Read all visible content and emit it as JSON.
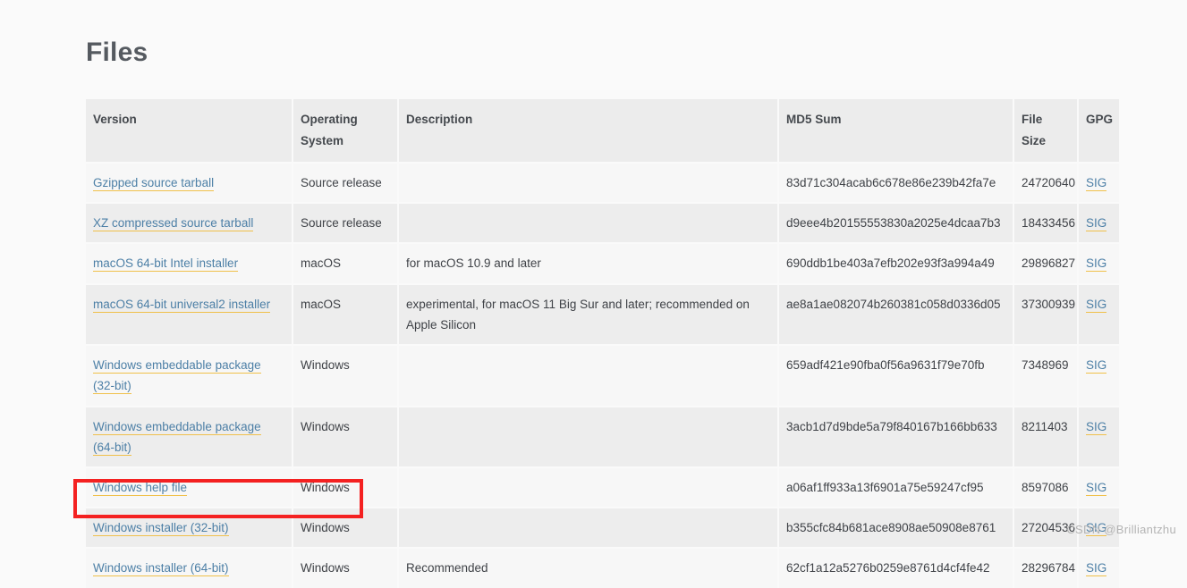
{
  "page": {
    "title": "Files",
    "watermark": "CSDN @Brilliantzhu"
  },
  "table": {
    "headers": {
      "version": "Version",
      "operating_system": "Operating System",
      "description": "Description",
      "md5_sum": "MD5 Sum",
      "file_size": "File Size",
      "gpg": "GPG"
    },
    "sig_label": "SIG",
    "rows": [
      {
        "version": "Gzipped source tarball",
        "os": "Source release",
        "description": "",
        "md5": "83d71c304acab6c678e86e239b42fa7e",
        "size": "24720640",
        "gpg": "SIG"
      },
      {
        "version": "XZ compressed source tarball",
        "os": "Source release",
        "description": "",
        "md5": "d9eee4b20155553830a2025e4dcaa7b3",
        "size": "18433456",
        "gpg": "SIG"
      },
      {
        "version": "macOS 64-bit Intel installer",
        "os": "macOS",
        "description": "for macOS 10.9 and later",
        "md5": "690ddb1be403a7efb202e93f3a994a49",
        "size": "29896827",
        "gpg": "SIG"
      },
      {
        "version": "macOS 64-bit universal2 installer",
        "os": "macOS",
        "description": "experimental, for macOS 11 Big Sur and later; recommended on Apple Silicon",
        "md5": "ae8a1ae082074b260381c058d0336d05",
        "size": "37300939",
        "gpg": "SIG"
      },
      {
        "version": "Windows embeddable package (32-bit)",
        "os": "Windows",
        "description": "",
        "md5": "659adf421e90fba0f56a9631f79e70fb",
        "size": "7348969",
        "gpg": "SIG"
      },
      {
        "version": "Windows embeddable package (64-bit)",
        "os": "Windows",
        "description": "",
        "md5": "3acb1d7d9bde5a79f840167b166bb633",
        "size": "8211403",
        "gpg": "SIG"
      },
      {
        "version": "Windows help file",
        "os": "Windows",
        "description": "",
        "md5": "a06af1ff933a13f6901a75e59247cf95",
        "size": "8597086",
        "gpg": "SIG"
      },
      {
        "version": "Windows installer (32-bit)",
        "os": "Windows",
        "description": "",
        "md5": "b355cfc84b681ace8908ae50908e8761",
        "size": "27204536",
        "gpg": "SIG"
      },
      {
        "version": "Windows installer (64-bit)",
        "os": "Windows",
        "description": "Recommended",
        "md5": "62cf1a12a5276b0259e8761d4cf4fe42",
        "size": "28296784",
        "gpg": "SIG"
      }
    ]
  },
  "annotation": {
    "color": "#f42121"
  }
}
